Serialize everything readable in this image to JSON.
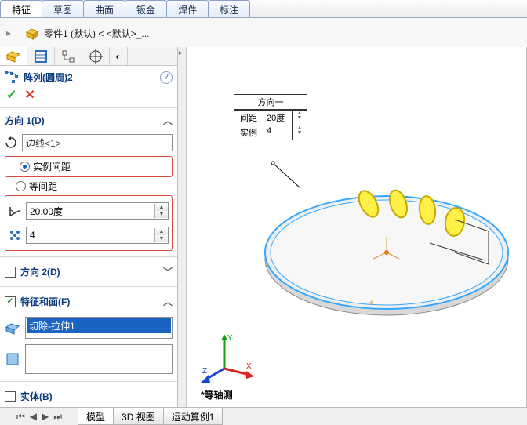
{
  "tabs": {
    "items": [
      "特征",
      "草图",
      "曲面",
      "钣金",
      "焊件",
      "标注"
    ],
    "active": 0
  },
  "part_name": "零件1  (默认)  < <默认>_...",
  "feature_title": "阵列(圆周)2",
  "dir1": {
    "label": "方向 1(D)",
    "axis_field": "边线<1>",
    "opt_instance_spacing": "实例间距",
    "opt_equal_spacing": "等间距",
    "angle": "20.00度",
    "count": "4"
  },
  "dir2_label": "方向 2(D)",
  "faces": {
    "label": "特征和面(F)",
    "item": "切除-拉伸1"
  },
  "solids_label": "实体(B)",
  "callout": {
    "title": "方向一",
    "spacing_label": "间距",
    "spacing_value": "20度",
    "count_label": "实例",
    "count_value": "4"
  },
  "iso_label": "*等轴测",
  "bottom_tabs": [
    "模型",
    "3D 视图",
    "运动算例1"
  ]
}
